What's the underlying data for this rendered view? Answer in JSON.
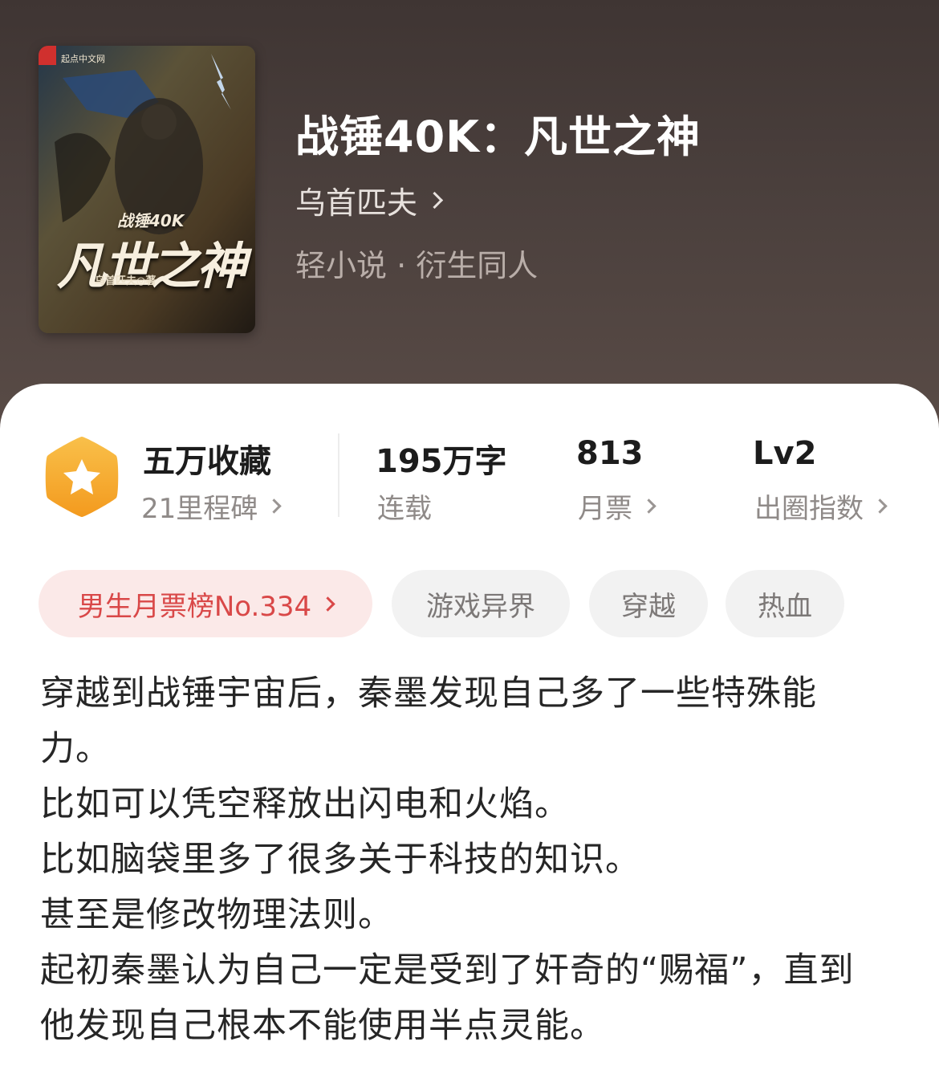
{
  "book": {
    "title": "战锤40K：凡世之神",
    "author": "乌首匹夫",
    "category": "轻小说 · 衍生同人"
  },
  "cover": {
    "publisher": "起点中文网",
    "subtitle": "战锤40K",
    "title": "凡世之神",
    "author_line": "乌首匹夫◎著"
  },
  "stats": {
    "collect": {
      "main": "五万收藏",
      "sub": "21里程碑"
    },
    "words": {
      "main": "195万字",
      "sub": "连载"
    },
    "tickets": {
      "main": "813",
      "sub": "月票"
    },
    "level": {
      "main": "Lv2",
      "sub": "出圈指数"
    }
  },
  "tags": [
    {
      "label": "男生月票榜No.334"
    },
    {
      "label": "游戏异界"
    },
    {
      "label": "穿越"
    },
    {
      "label": "热血"
    }
  ],
  "description": [
    "穿越到战锤宇宙后，秦墨发现自己多了一些特殊能",
    "力。",
    "比如可以凭空释放出闪电和火焰。",
    "比如脑袋里多了很多关于科技的知识。",
    "甚至是修改物理法则。",
    "起初秦墨认为自己一定是受到了奸奇的“赐福”，直到",
    "他发现自己根本不能使用半点灵能。"
  ],
  "colors": {
    "header_bg": "#4b403d",
    "rank_tag_bg": "#fbe9e8",
    "rank_tag_text": "#d94848",
    "medal": "#f6a623"
  }
}
